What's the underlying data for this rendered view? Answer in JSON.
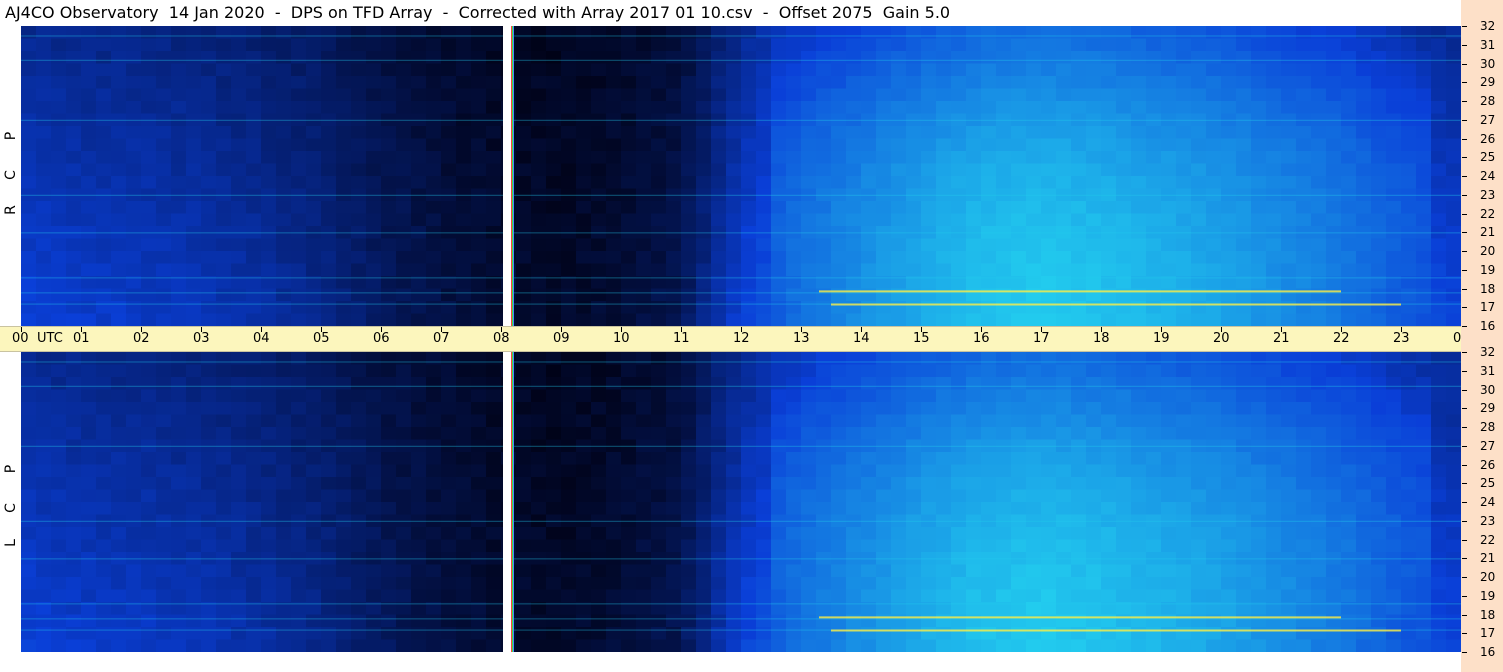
{
  "title": "AJ4CO Observatory  14 Jan 2020  -  DPS on TFD Array  -  Corrected with Array 2017 01 10.csv  -  Offset 2075  Gain 5.0",
  "chart_data": {
    "type": "heatmap",
    "panels": [
      {
        "polarization": "RCP",
        "letters": [
          "R",
          "C",
          "P"
        ]
      },
      {
        "polarization": "LCP",
        "letters": [
          "L",
          "C",
          "P"
        ]
      }
    ],
    "x": {
      "unit": "UTC",
      "ticks": [
        "00",
        "01",
        "02",
        "03",
        "04",
        "05",
        "06",
        "07",
        "08",
        "09",
        "10",
        "11",
        "12",
        "13",
        "14",
        "15",
        "16",
        "17",
        "18",
        "19",
        "20",
        "21",
        "22",
        "23",
        "00"
      ],
      "range": [
        0,
        24
      ]
    },
    "y": {
      "unit": "MHz",
      "ticks": [
        "16",
        "17",
        "18",
        "19",
        "20",
        "21",
        "22",
        "23",
        "24",
        "25",
        "26",
        "27",
        "28",
        "29",
        "30",
        "31",
        "32"
      ],
      "range": [
        16,
        32
      ]
    },
    "intensity_profile_by_hour": [
      0.3,
      0.28,
      0.27,
      0.25,
      0.22,
      0.18,
      0.12,
      0.08,
      0.05,
      0.04,
      0.06,
      0.1,
      0.3,
      0.42,
      0.5,
      0.58,
      0.64,
      0.66,
      0.64,
      0.6,
      0.56,
      0.5,
      0.44,
      0.36,
      0.3
    ],
    "gap_utc": 8.2,
    "colors": {
      "low": "#000010",
      "mid": "#0a3fd8",
      "high": "#22ccee",
      "peak": "#ffee44",
      "time_bar": "#fcf6bd",
      "freq_axis": "#fde0c8"
    }
  }
}
